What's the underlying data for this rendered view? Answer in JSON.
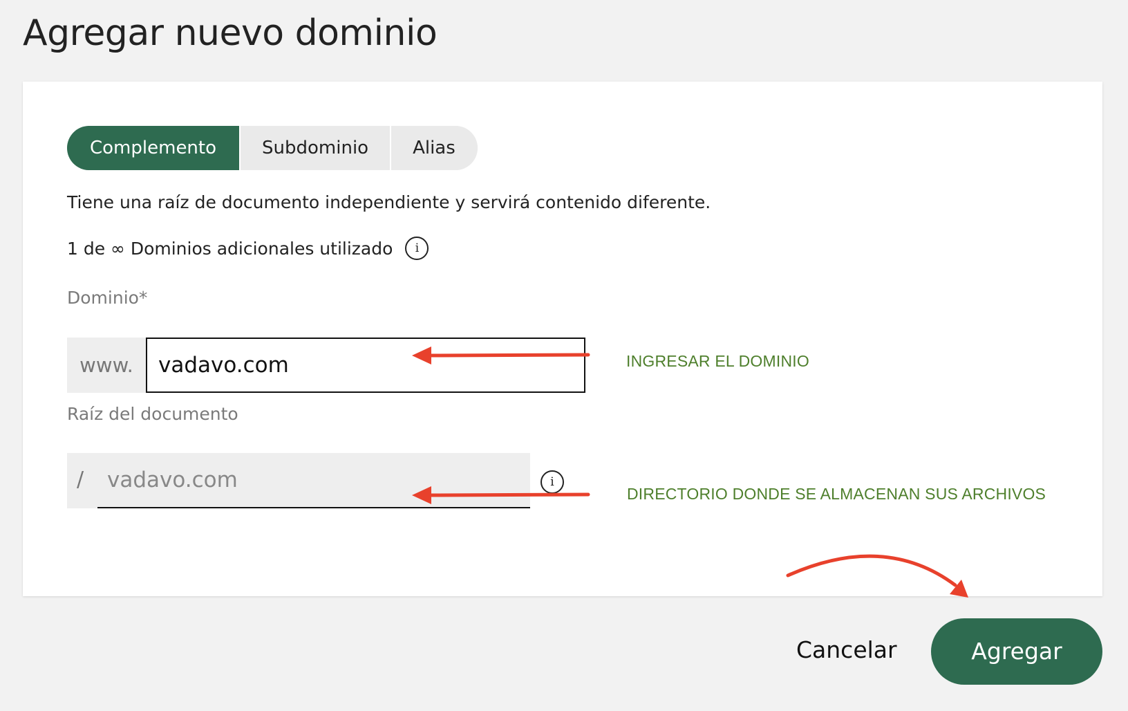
{
  "page": {
    "title": "Agregar nuevo dominio"
  },
  "tabs": [
    {
      "label": "Complemento",
      "active": true
    },
    {
      "label": "Subdominio",
      "active": false
    },
    {
      "label": "Alias",
      "active": false
    }
  ],
  "description": "Tiene una raíz de documento independiente y servirá contenido diferente.",
  "usage": {
    "text": "1 de ∞ Dominios adicionales utilizado",
    "icon": "info-icon"
  },
  "domain_field": {
    "label": "Dominio*",
    "prefix": "www.",
    "value": "vadavo.com"
  },
  "root_field": {
    "label": "Raíz del documento",
    "prefix": "/",
    "value": "vadavo.com",
    "icon": "info-icon"
  },
  "annotations": {
    "domain_note": "INGRESAR EL DOMINIO",
    "root_note": "DIRECTORIO DONDE SE ALMACENAN SUS ARCHIVOS",
    "arrow_color": "#e8412c",
    "note_color": "#4e7f2c"
  },
  "actions": {
    "cancel_label": "Cancelar",
    "submit_label": "Agregar"
  },
  "colors": {
    "primary": "#2e6b50",
    "background": "#f2f2f2",
    "card": "#ffffff"
  }
}
